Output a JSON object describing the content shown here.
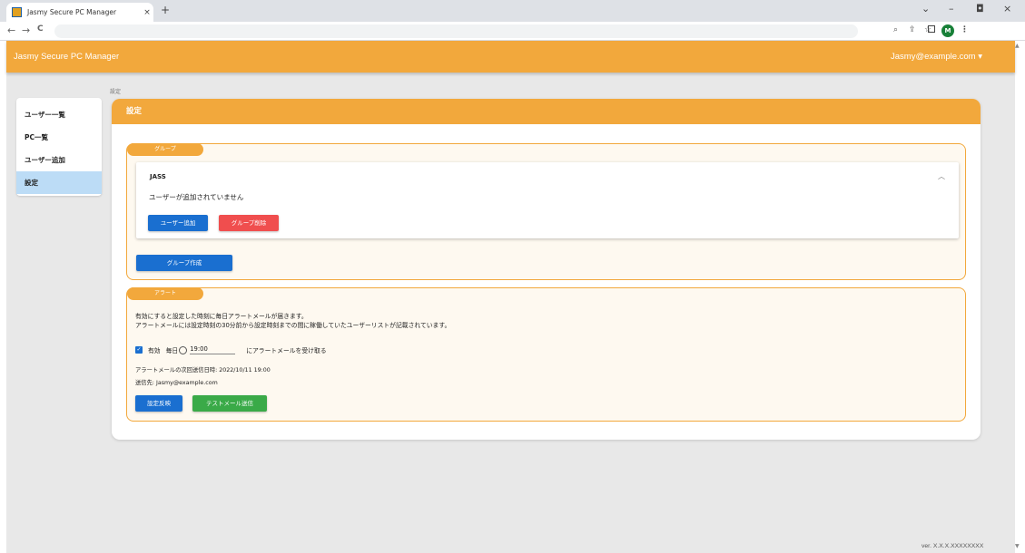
{
  "browser": {
    "tab_title": "Jasmy Secure PC Manager",
    "tab_close": "×",
    "new_tab": "+",
    "back": "←",
    "forward": "→",
    "reload": "C",
    "avatar_letter": "M",
    "minimize": "–",
    "maximize": "◘",
    "close": "×"
  },
  "app": {
    "title": "Jasmy Secure PC Manager",
    "user_menu": "Jasmy@example.com ▾",
    "version": "ver. X.X.X.XXXXXXXX"
  },
  "sidebar": {
    "items": [
      {
        "label": "ユーザー一覧",
        "active": false
      },
      {
        "label": "PC一覧",
        "active": false
      },
      {
        "label": "ユーザー追加",
        "active": false
      },
      {
        "label": "設定",
        "active": true
      }
    ]
  },
  "breadcrumb": "設定",
  "page_title": "設定",
  "group_section": {
    "label": "グループ",
    "groups": [
      {
        "name": "JASS",
        "empty_message": "ユーザーが追加されていません",
        "add_user_label": "ユーザー追加",
        "delete_group_label": "グループ削除"
      }
    ],
    "create_group_label": "グループ作成"
  },
  "alert_section": {
    "label": "アラート",
    "description_line1": "有効にすると設定した時刻に毎日アラートメールが届きます。",
    "description_line2": "アラートメールには設定時刻の30分前から設定時刻までの間に稼働していたユーザーリストが記載されています。",
    "enabled_label": "有効",
    "daily_label": "毎日",
    "time_value": "19:00",
    "receive_label": "にアラートメールを受け取る",
    "next_send": "アラートメールの次回送信日時: 2022/10/11 19:00",
    "recipient": "送信先: Jasmy@example.com",
    "apply_label": "設定反映",
    "test_mail_label": "テストメール送信"
  }
}
